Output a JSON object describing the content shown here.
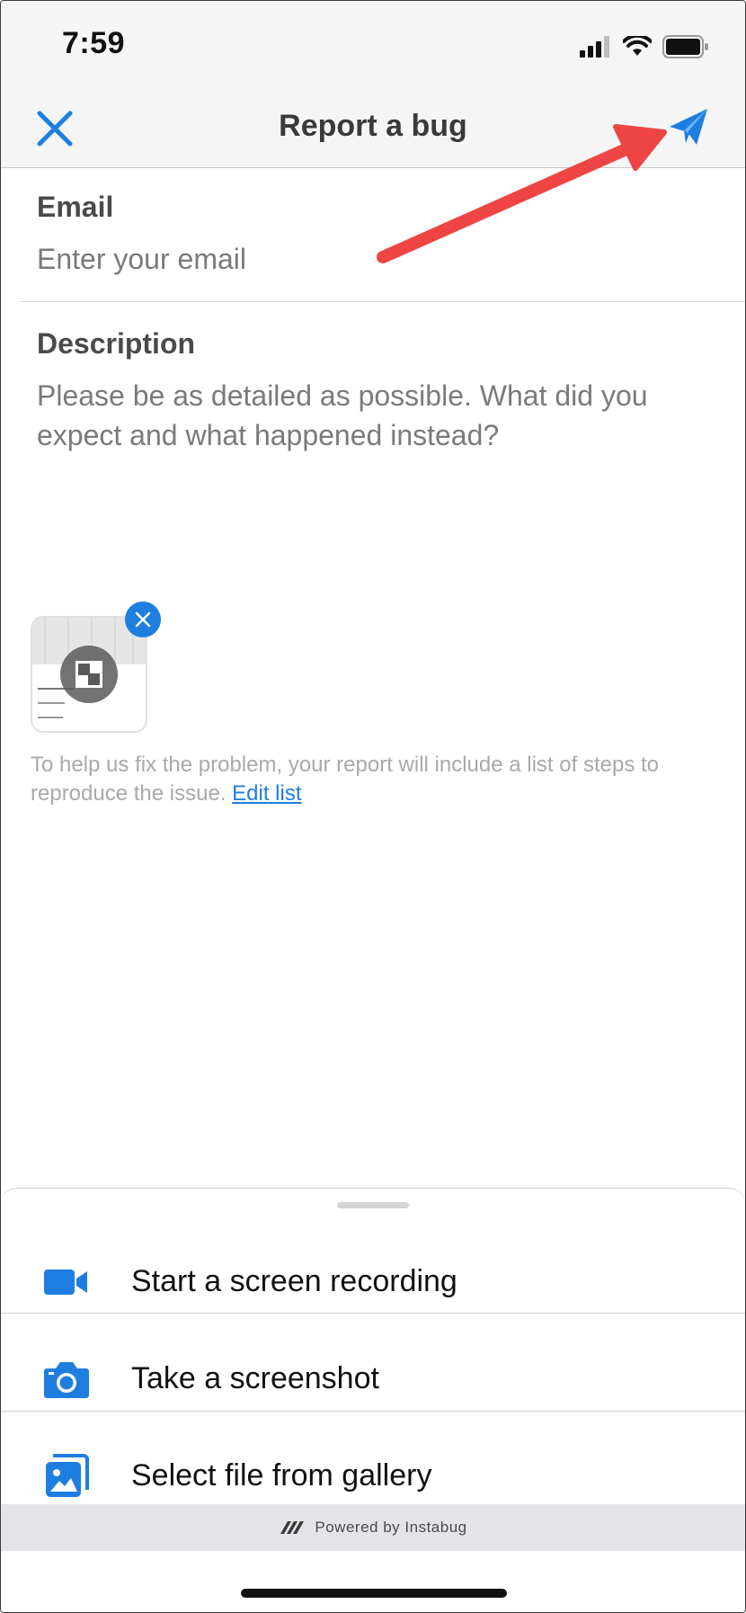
{
  "status_bar": {
    "time": "7:59"
  },
  "nav": {
    "title": "Report a bug"
  },
  "form": {
    "email_label": "Email",
    "email_placeholder": "Enter your email",
    "description_label": "Description",
    "description_placeholder": "Please be as detailed as possible. What did you expect and what happened instead?"
  },
  "hint": {
    "text": "To help us fix the problem, your report will include a list of steps to reproduce the issue. ",
    "link": "Edit list"
  },
  "sheet": {
    "items": [
      {
        "label": "Start a screen recording",
        "icon": "video-camera-icon"
      },
      {
        "label": "Take a screenshot",
        "icon": "camera-icon"
      },
      {
        "label": "Select file from gallery",
        "icon": "gallery-icon"
      }
    ]
  },
  "footer": {
    "powered_by": "Powered by Instabug"
  },
  "colors": {
    "accent": "#1e7ee0",
    "annotation": "#ef4444"
  }
}
